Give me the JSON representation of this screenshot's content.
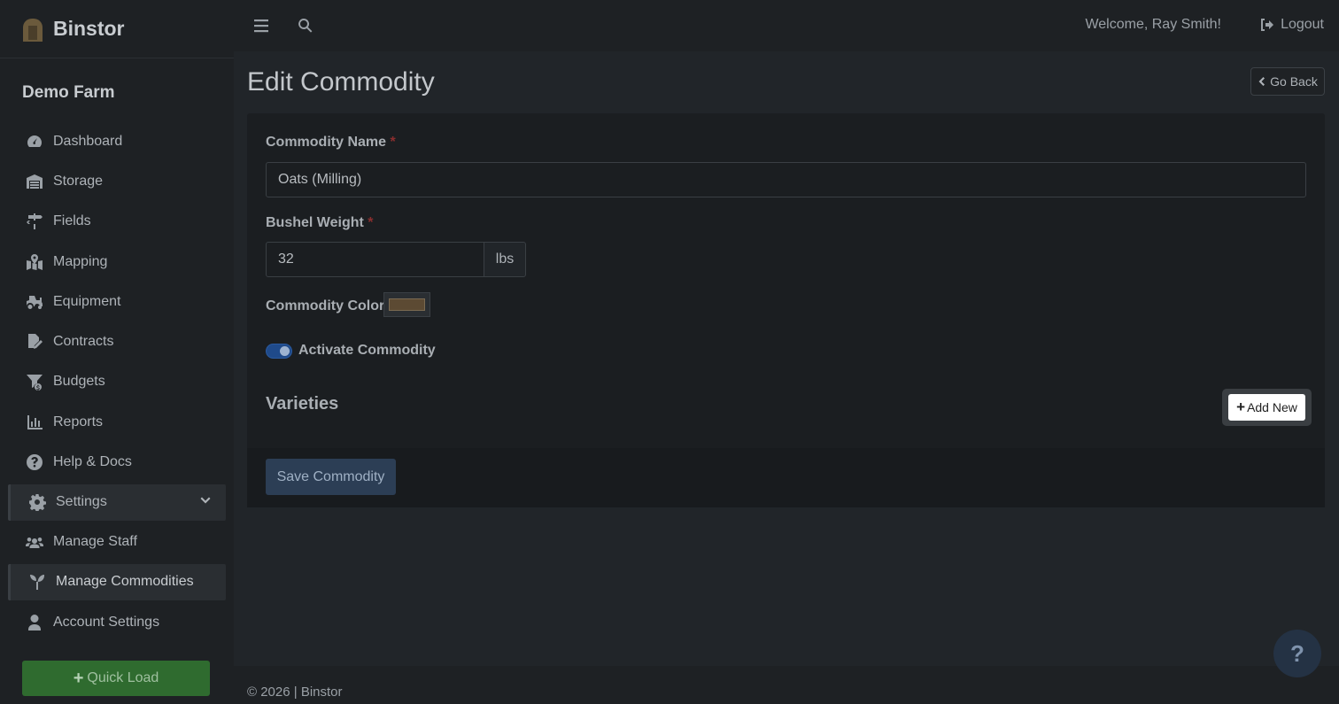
{
  "brand": {
    "name": "Binstor"
  },
  "farm_name": "Demo Farm",
  "sidebar": {
    "items": [
      {
        "label": "Dashboard",
        "icon": "gauge-icon"
      },
      {
        "label": "Storage",
        "icon": "warehouse-icon"
      },
      {
        "label": "Fields",
        "icon": "signpost-icon"
      },
      {
        "label": "Mapping",
        "icon": "map-icon"
      },
      {
        "label": "Equipment",
        "icon": "tractor-icon"
      },
      {
        "label": "Contracts",
        "icon": "file-signature-icon"
      },
      {
        "label": "Budgets",
        "icon": "funnel-dollar-icon"
      },
      {
        "label": "Reports",
        "icon": "chart-bar-icon"
      },
      {
        "label": "Help & Docs",
        "icon": "question-circle-icon"
      },
      {
        "label": "Settings",
        "icon": "gear-icon"
      },
      {
        "label": "Manage Staff",
        "icon": "users-icon"
      },
      {
        "label": "Manage Commodities",
        "icon": "seedling-icon"
      },
      {
        "label": "Account Settings",
        "icon": "user-icon"
      }
    ],
    "quick_load": "Quick Load"
  },
  "topbar": {
    "welcome": "Welcome, Ray Smith!",
    "logout": "Logout"
  },
  "page": {
    "title": "Edit Commodity",
    "go_back": "Go Back"
  },
  "form": {
    "commodity_name_label": "Commodity Name",
    "commodity_name_value": "Oats (Milling)",
    "bushel_weight_label": "Bushel Weight",
    "bushel_weight_value": "32",
    "bushel_weight_unit": "lbs",
    "commodity_color_label": "Commodity Color",
    "commodity_color_value": "#5c4a33",
    "activate_label": "Activate Commodity",
    "activate_on": true,
    "required_marker": "*",
    "varieties_heading": "Varieties",
    "add_new": "Add New",
    "save": "Save Commodity"
  },
  "footer": {
    "text": "© 2026 | Binstor"
  },
  "help_fab": "?"
}
